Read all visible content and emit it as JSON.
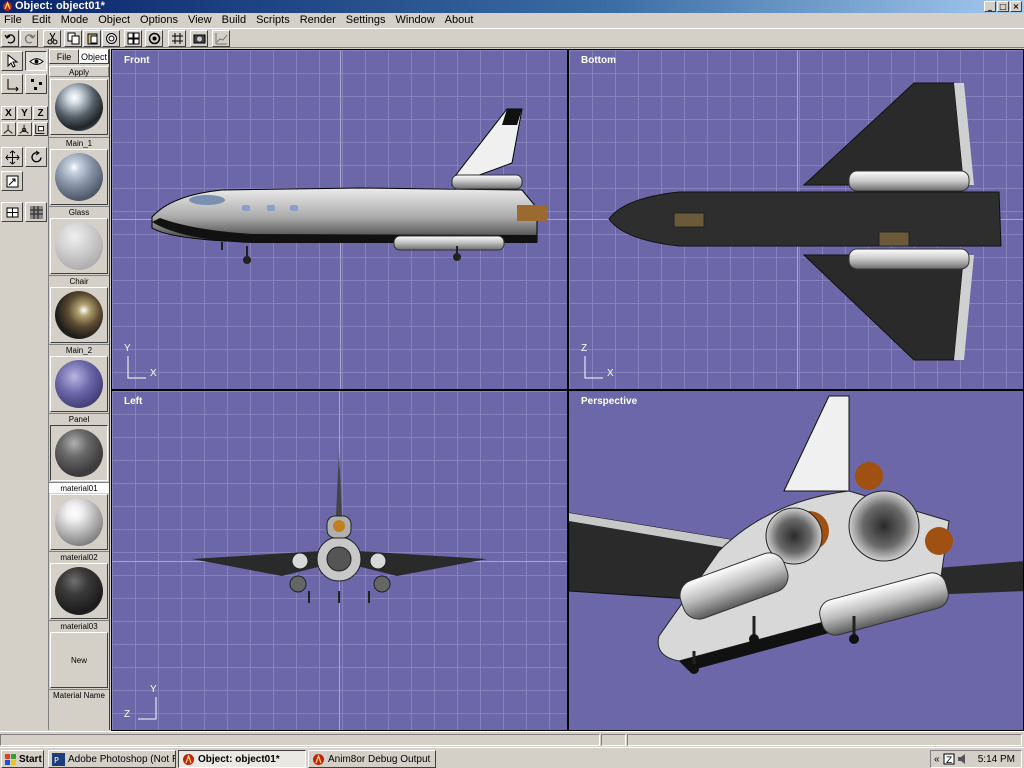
{
  "window": {
    "title": "Object: object01*"
  },
  "window_buttons": {
    "minimize": "_",
    "maximize": "□",
    "close": "×"
  },
  "menu": [
    "File",
    "Edit",
    "Mode",
    "Object",
    "Options",
    "View",
    "Build",
    "Scripts",
    "Render",
    "Settings",
    "Window",
    "About"
  ],
  "tools": {
    "x_label": "X",
    "y_label": "Y",
    "z_label": "Z"
  },
  "materials": {
    "tabs": [
      "File",
      "Object"
    ],
    "apply_label": "Apply",
    "items": [
      {
        "name": "Main_1",
        "icon": "material-sphere-chrome"
      },
      {
        "name": "Glass",
        "icon": "material-sphere-glass"
      },
      {
        "name": "Chair",
        "icon": "material-sphere-matte"
      },
      {
        "name": "Main_2",
        "icon": "material-sphere-env"
      },
      {
        "name": "Panel",
        "icon": "material-sphere-panel"
      },
      {
        "name": "material01",
        "icon": "material-sphere-dark"
      },
      {
        "name": "material02",
        "icon": "material-sphere-white"
      },
      {
        "name": "material03",
        "icon": "material-sphere-black"
      }
    ],
    "new_label": "New",
    "name_label": "Material Name"
  },
  "viewports": {
    "front": {
      "title": "Front",
      "axis_v": "Y",
      "axis_h": "X"
    },
    "bottom": {
      "title": "Bottom",
      "axis_v": "Z",
      "axis_h": "X"
    },
    "left": {
      "title": "Left",
      "axis_v": "Y",
      "axis_h": "Z"
    },
    "perspective": {
      "title": "Perspective"
    }
  },
  "colors": {
    "viewport_bg": "#6b67a8",
    "grid": "#8682bc",
    "title_bar": "#0a246a"
  },
  "taskbar": {
    "start_label": "Start",
    "tasks": [
      {
        "label": "Adobe Photoshop (Not R...",
        "active": false
      },
      {
        "label": "Object: object01*",
        "active": true
      },
      {
        "label": "Anim8or Debug Output",
        "active": false
      }
    ],
    "tray_chevron": "«",
    "clock": "5:14 PM"
  }
}
